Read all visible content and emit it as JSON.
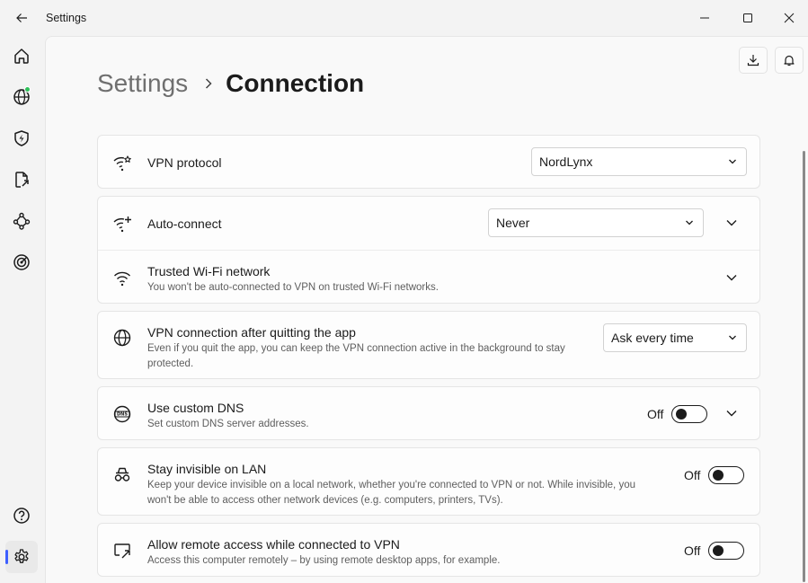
{
  "window": {
    "title": "Settings"
  },
  "sidebar": {
    "items": [
      {
        "icon": "home-icon"
      },
      {
        "icon": "globe-icon",
        "status_color": "#2fc05a"
      },
      {
        "icon": "shield-bolt-icon"
      },
      {
        "icon": "file-share-icon"
      },
      {
        "icon": "meshnet-icon"
      },
      {
        "icon": "target-icon"
      },
      {
        "icon": "help-icon"
      },
      {
        "icon": "gear-icon",
        "active": true
      }
    ]
  },
  "header": {
    "breadcrumb_root": "Settings",
    "breadcrumb_current": "Connection"
  },
  "settings": {
    "vpn_protocol": {
      "title": "VPN protocol",
      "value": "NordLynx"
    },
    "auto_connect": {
      "title": "Auto-connect",
      "value": "Never"
    },
    "trusted_wifi": {
      "title": "Trusted Wi-Fi network",
      "desc": "You won't be auto-connected to VPN on trusted Wi-Fi networks."
    },
    "after_quit": {
      "title": "VPN connection after quitting the app",
      "desc": "Even if you quit the app, you can keep the VPN connection active in the background to stay protected.",
      "value": "Ask every time"
    },
    "custom_dns": {
      "title": "Use custom DNS",
      "desc": "Set custom DNS server addresses.",
      "state": "Off"
    },
    "invisible_lan": {
      "title": "Stay invisible on LAN",
      "desc": "Keep your device invisible on a local network, whether you're connected to VPN or not. While invisible, you won't be able to access other network devices (e.g. computers, printers, TVs).",
      "state": "Off"
    },
    "remote_access": {
      "title": "Allow remote access while connected to VPN",
      "desc": "Access this computer remotely – by using remote desktop apps, for example.",
      "state": "Off"
    }
  },
  "colors": {
    "accent": "#3e5fff",
    "status_connected": "#2fc05a"
  }
}
